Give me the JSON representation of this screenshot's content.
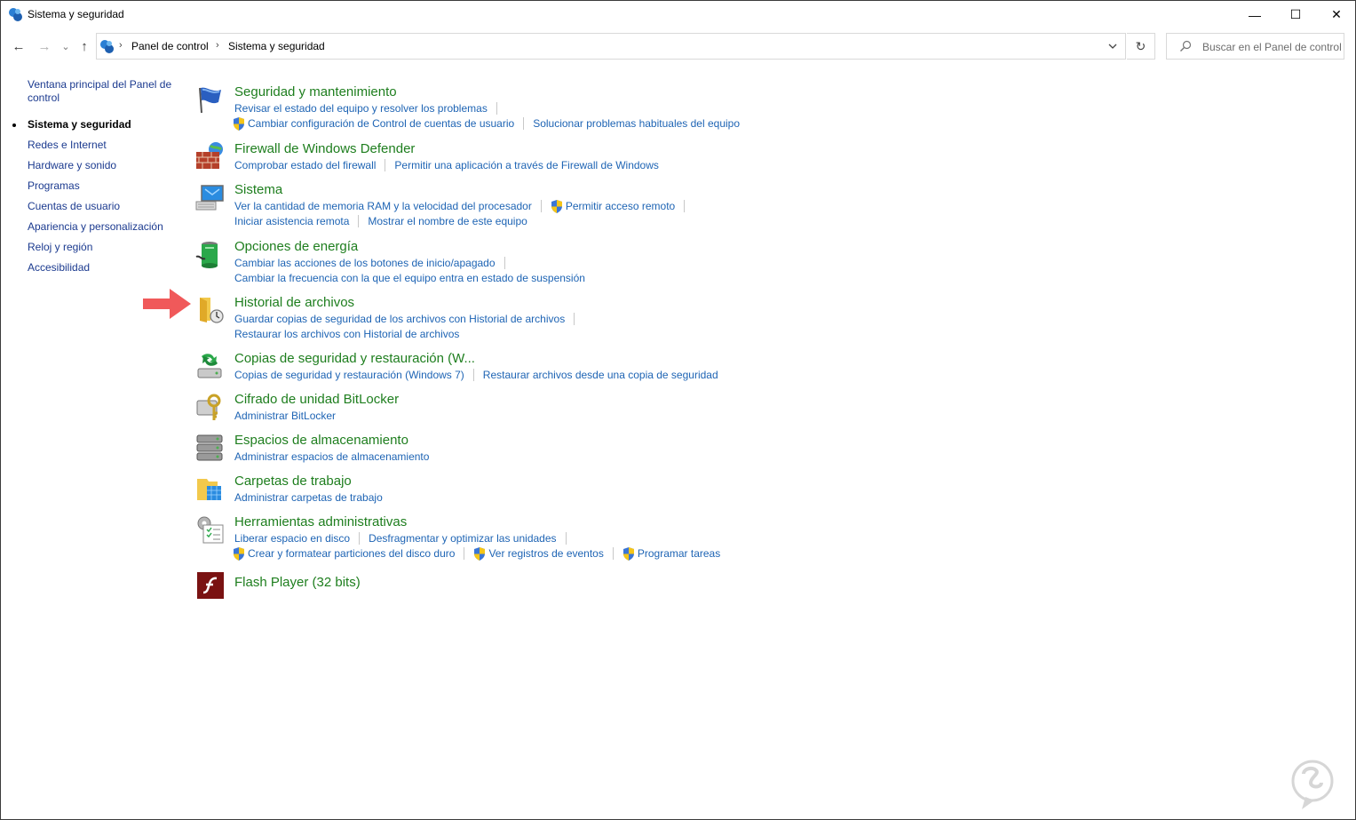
{
  "window": {
    "title": "Sistema y seguridad",
    "icon": "control-panel-icon",
    "controls": {
      "minimize": "—",
      "maximize": "☐",
      "close": "✕"
    }
  },
  "nav": {
    "back": "←",
    "forward": "→",
    "recent": "⌄",
    "up": "↑",
    "breadcrumb": [
      "Panel de control",
      "Sistema y seguridad"
    ],
    "refresh": "↻",
    "search_placeholder": "Buscar en el Panel de control"
  },
  "sidebar": {
    "items": [
      {
        "label": "Ventana principal del Panel de control",
        "active": false
      },
      {
        "label": "Sistema y seguridad",
        "active": true
      },
      {
        "label": "Redes e Internet",
        "active": false
      },
      {
        "label": "Hardware y sonido",
        "active": false
      },
      {
        "label": "Programas",
        "active": false
      },
      {
        "label": "Cuentas de usuario",
        "active": false
      },
      {
        "label": "Apariencia y personalización",
        "active": false
      },
      {
        "label": "Reloj y región",
        "active": false
      },
      {
        "label": "Accesibilidad",
        "active": false
      }
    ]
  },
  "categories": [
    {
      "title": "Seguridad y mantenimiento",
      "icon": "flag-icon",
      "rows": [
        [
          {
            "label": "Revisar el estado del equipo y resolver los problemas"
          }
        ],
        [
          {
            "label": "Cambiar configuración de Control de cuentas de usuario",
            "shield": true
          },
          {
            "label": "Solucionar problemas habituales del equipo"
          }
        ]
      ]
    },
    {
      "title": "Firewall de Windows Defender",
      "icon": "firewall-icon",
      "rows": [
        [
          {
            "label": "Comprobar estado del firewall"
          },
          {
            "label": "Permitir una aplicación a través de Firewall de Windows"
          }
        ]
      ]
    },
    {
      "title": "Sistema",
      "icon": "computer-icon",
      "rows": [
        [
          {
            "label": "Ver la cantidad de memoria RAM y la velocidad del procesador"
          },
          {
            "label": "Permitir acceso remoto",
            "shield": true
          }
        ],
        [
          {
            "label": "Iniciar asistencia remota"
          },
          {
            "label": "Mostrar el nombre de este equipo"
          }
        ]
      ]
    },
    {
      "title": "Opciones de energía",
      "icon": "battery-icon",
      "rows": [
        [
          {
            "label": "Cambiar las acciones de los botones de inicio/apagado"
          }
        ],
        [
          {
            "label": "Cambiar la frecuencia con la que el equipo entra en estado de suspensión"
          }
        ]
      ]
    },
    {
      "title": "Historial de archivos",
      "icon": "file-history-icon",
      "rows": [
        [
          {
            "label": "Guardar copias de seguridad de los archivos con Historial de archivos"
          }
        ],
        [
          {
            "label": "Restaurar los archivos con Historial de archivos"
          }
        ]
      ]
    },
    {
      "title": "Copias de seguridad y restauración (W...",
      "icon": "backup-icon",
      "rows": [
        [
          {
            "label": "Copias de seguridad y restauración (Windows 7)"
          },
          {
            "label": "Restaurar archivos desde una copia de seguridad"
          }
        ]
      ]
    },
    {
      "title": "Cifrado de unidad BitLocker",
      "icon": "bitlocker-icon",
      "rows": [
        [
          {
            "label": "Administrar BitLocker"
          }
        ]
      ]
    },
    {
      "title": "Espacios de almacenamiento",
      "icon": "storage-icon",
      "rows": [
        [
          {
            "label": "Administrar espacios de almacenamiento"
          }
        ]
      ]
    },
    {
      "title": "Carpetas de trabajo",
      "icon": "work-folders-icon",
      "rows": [
        [
          {
            "label": "Administrar carpetas de trabajo"
          }
        ]
      ]
    },
    {
      "title": "Herramientas administrativas",
      "icon": "admin-tools-icon",
      "rows": [
        [
          {
            "label": "Liberar espacio en disco"
          },
          {
            "label": "Desfragmentar y optimizar las unidades"
          }
        ],
        [
          {
            "label": "Crear y formatear particiones del disco duro",
            "shield": true
          },
          {
            "label": "Ver registros de eventos",
            "shield": true
          },
          {
            "label": "Programar tareas",
            "shield": true
          }
        ]
      ]
    },
    {
      "title": "Flash Player (32 bits)",
      "icon": "flash-icon",
      "rows": []
    }
  ],
  "annotation": {
    "icon": "red-arrow-icon",
    "color": "#f0595a"
  },
  "colors": {
    "category_title": "#1e7e1e",
    "link": "#1e64b4",
    "sidebar_link": "#1b3a8f"
  }
}
